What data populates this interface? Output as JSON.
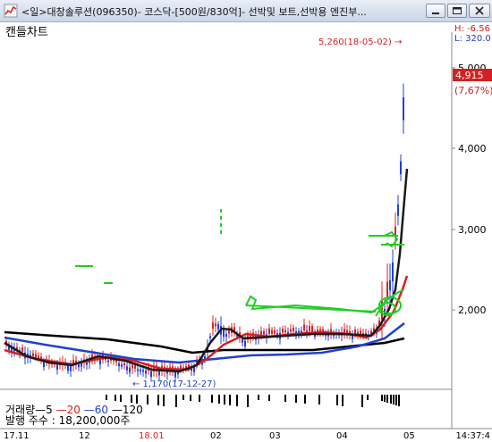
{
  "window": {
    "title": "<일>대창솔루션(096350)- 코스닥-[500원/830억]- 선박및 보트,선박용 엔진부..."
  },
  "chart_name": "캔들차트",
  "high_low": {
    "high": "H: -6.56",
    "low": "L: 320.0"
  },
  "price_labels": {
    "max_annotation": "5,260(18-05-02) →",
    "min_annotation": "← 1,170(17-12-27)",
    "current_price": "4,915",
    "current_change": "(7,67%)"
  },
  "colors": {
    "up": "#e02020",
    "down": "#2040d0",
    "ma5": "#000000",
    "ma20": "#d42020",
    "ma60": "#2040d0",
    "ma120": "#000000",
    "annotation_green": "#22cc22"
  },
  "volume": {
    "legend_label": "거래량",
    "ma5": "5",
    "ma20": "20",
    "ma60": "60",
    "ma120": "120",
    "shares_issued": "발행 주수 :  18,200,000주"
  },
  "status_time": "14:37:4",
  "chart_data": {
    "type": "candlestick",
    "y_ticks": [
      "5,000",
      "4,000",
      "3,000",
      "2,000"
    ],
    "x_ticks": [
      "17.11",
      "12",
      "18.01",
      "02",
      "03",
      "04",
      "05"
    ],
    "ylim": [
      1000,
      5500
    ],
    "max": {
      "value": 5260,
      "date": "18-05-02"
    },
    "min": {
      "value": 1170,
      "date": "17-12-27"
    },
    "last": 4915,
    "change_pct": "7,67%"
  }
}
